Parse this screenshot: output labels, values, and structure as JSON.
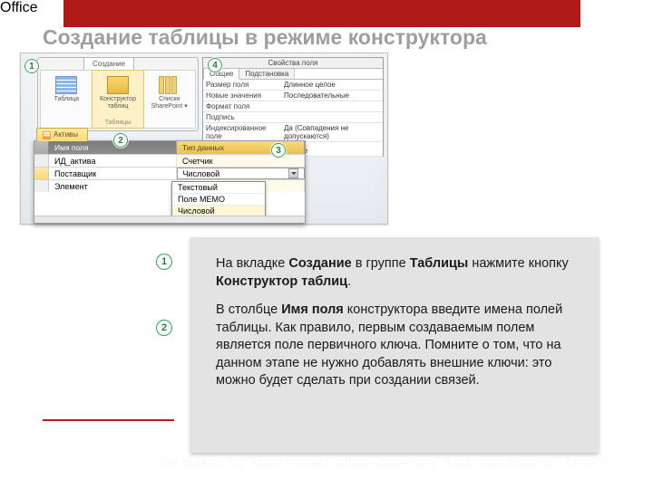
{
  "slide_title": "Создание таблицы в режиме конструктора",
  "ribbon": {
    "tab_label": "Создание",
    "buttons": {
      "table": "Таблица",
      "designer_line1": "Конструктор",
      "designer_line2": "таблиц",
      "sharepoint_line1": "Списки",
      "sharepoint_line2": "SharePoint ▾"
    },
    "group_label": "Таблицы"
  },
  "props": {
    "title": "Свойства поля",
    "tab_general": "Общие",
    "tab_lookup": "Подстановка",
    "rows": [
      {
        "k": "Размер поля",
        "v": "Длинное целое"
      },
      {
        "k": "Новые значения",
        "v": "Последовательные"
      },
      {
        "k": "Формат поля",
        "v": ""
      },
      {
        "k": "Подпись",
        "v": ""
      },
      {
        "k": "Индексированное поле",
        "v": "Да (Совпадения не допускаются)"
      }
    ],
    "spacer_row": {
      "k": "",
      "v": "Общее"
    }
  },
  "design_grid": {
    "tab_label": "Активы",
    "col_name": "Имя поля",
    "col_type": "Тип данных",
    "rows": [
      {
        "name": "ИД_актива",
        "type": "Счетчик",
        "selected": false
      },
      {
        "name": "Поставщик",
        "type": "Числовой",
        "selected": true,
        "current": true
      },
      {
        "name": "Элемент",
        "type": "",
        "selected": false
      }
    ],
    "dropdown": [
      "Текстовый",
      "Поле МЕМО",
      "Числовой"
    ]
  },
  "screenshot_callouts": {
    "1": "1",
    "2": "2",
    "3": "3",
    "4": "4"
  },
  "body_callouts": {
    "1": "1",
    "2": "2"
  },
  "paragraphs": {
    "p1_a": "На вкладке ",
    "p1_b": "Создание",
    "p1_c": " в группе ",
    "p1_d": "Таблицы",
    "p1_e": " нажмите кнопку ",
    "p1_f": "Конструктор таблиц",
    "p1_g": ".",
    "p2_a": "В столбце ",
    "p2_b": "Имя поля",
    "p2_c": " конструктора введите имена полей таблицы. Как правило, первым создаваемым полем является поле первичного ключа. Помните о том, что на данном этапе не нужно добавлять внешние ключи: это можно будет сделать при создании связей."
  },
  "footer": {
    "logo_text": "Office"
  }
}
